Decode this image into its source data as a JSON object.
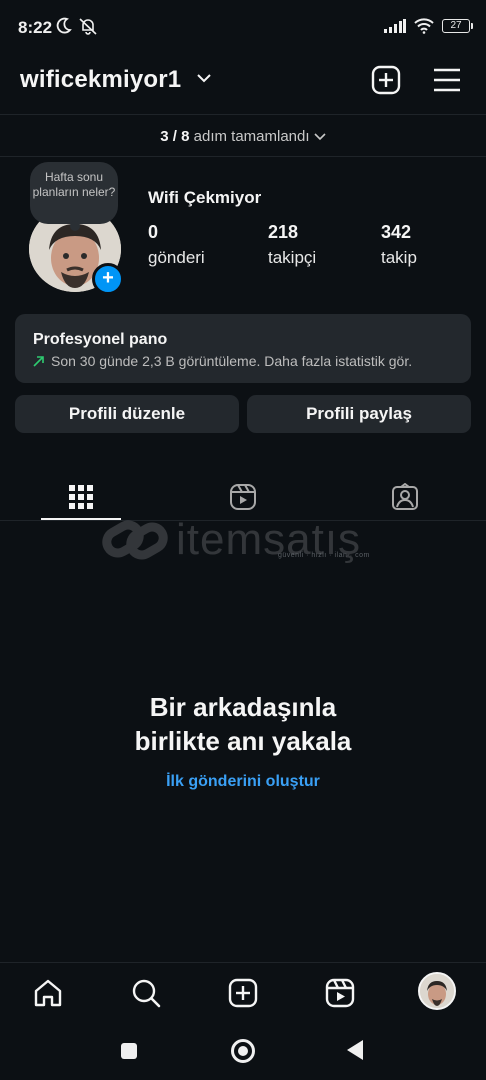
{
  "status_bar": {
    "time": "8:22",
    "battery": "27"
  },
  "header": {
    "username": "wificekmiyor1"
  },
  "progress": {
    "current": "3 / 8",
    "label": "adım tamamlandı"
  },
  "profile": {
    "note": "Hafta sonu planların neler?",
    "display_name": "Wifi Çekmiyor",
    "stats": [
      {
        "value": "0",
        "label": "gönderi"
      },
      {
        "value": "218",
        "label": "takipçi"
      },
      {
        "value": "342",
        "label": "takip"
      }
    ]
  },
  "professional_dashboard": {
    "title": "Profesyonel pano",
    "subtitle": "Son 30 günde 2,3 B görüntüleme. Daha fazla istatistik gör."
  },
  "buttons": {
    "edit_profile": "Profili düzenle",
    "share_profile": "Profili paylaş"
  },
  "watermark": {
    "brand": "itemsatış",
    "tagline": "güvenli · hızlı · ilan · com"
  },
  "empty_state": {
    "title_line1": "Bir arkadaşınla",
    "title_line2": "birlikte anı yakala",
    "link": "İlk gönderini oluştur"
  },
  "tabs": [
    "grid-icon",
    "reels-icon",
    "tagged-icon"
  ],
  "bottom_nav": [
    "home-icon",
    "search-icon",
    "create-icon",
    "reels-icon",
    "profile-avatar"
  ],
  "colors": {
    "background": "#0c1014",
    "card": "#23282d",
    "accent": "#0095f6",
    "link": "#3aa0f5"
  }
}
